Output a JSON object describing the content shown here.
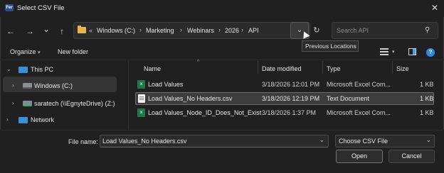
{
  "window": {
    "title": "Select CSV File",
    "app_icon_text": "Fer",
    "close_glyph": "✕"
  },
  "nav": {
    "back_glyph": "←",
    "forward_glyph": "→",
    "recent_glyph": "⌄",
    "up_glyph": "↑",
    "overflow": "«",
    "breadcrumbs": [
      "Windows (C:)",
      "Marketing",
      "Webinars",
      "2026",
      "API"
    ],
    "separator": "›",
    "previous_locations_glyph": "⌄",
    "refresh_glyph": "↻",
    "search_placeholder": "Search API",
    "search_glyph": "⚲",
    "tooltip": "Previous Locations"
  },
  "commandbar": {
    "organize": "Organize",
    "organize_caret": "▾",
    "new_folder": "New folder",
    "view_caret": "▾",
    "help_glyph": "?"
  },
  "sidebar": {
    "items": [
      {
        "label": "This PC",
        "chevron": "⌄",
        "icon": "this-pc-icon"
      },
      {
        "label": "Windows (C:)",
        "chevron": "›",
        "icon": "drive-icon"
      },
      {
        "label": "saratech (\\\\EgnyteDrive) (Z:)",
        "chevron": "›",
        "icon": "network-drive-icon"
      },
      {
        "label": "Network",
        "chevron": "›",
        "icon": "network-icon"
      }
    ]
  },
  "file_list": {
    "columns": [
      "Name",
      "Date modified",
      "Type",
      "Size"
    ],
    "sort_glyph": "^",
    "rows": [
      {
        "name": "Load Values",
        "date": "3/18/2026 12:01 PM",
        "type": "Microsoft Excel Com...",
        "size": "1 KB",
        "icon": "excel-csv-icon",
        "selected": false
      },
      {
        "name": "Load Values_No Headers.csv",
        "date": "3/18/2026 12:19 PM",
        "type": "Text Document",
        "size": "1 KB",
        "icon": "text-document-icon",
        "selected": true
      },
      {
        "name": "Load Values_Node_ID_Does_Not_Exist",
        "date": "3/18/2026 1:37 PM",
        "type": "Microsoft Excel Com...",
        "size": "1 KB",
        "icon": "excel-csv-icon",
        "selected": false
      }
    ]
  },
  "footer": {
    "file_name_label": "File name:",
    "file_name_value": "Load Values_No Headers.csv",
    "dropdown_glyph": "⌄",
    "file_type_value": "Choose CSV File",
    "open_label": "Open",
    "cancel_label": "Cancel"
  },
  "colors": {
    "background": "#202020",
    "accent": "#2f8be0",
    "folder": "#e8b54a",
    "excel": "#1d7a45"
  }
}
